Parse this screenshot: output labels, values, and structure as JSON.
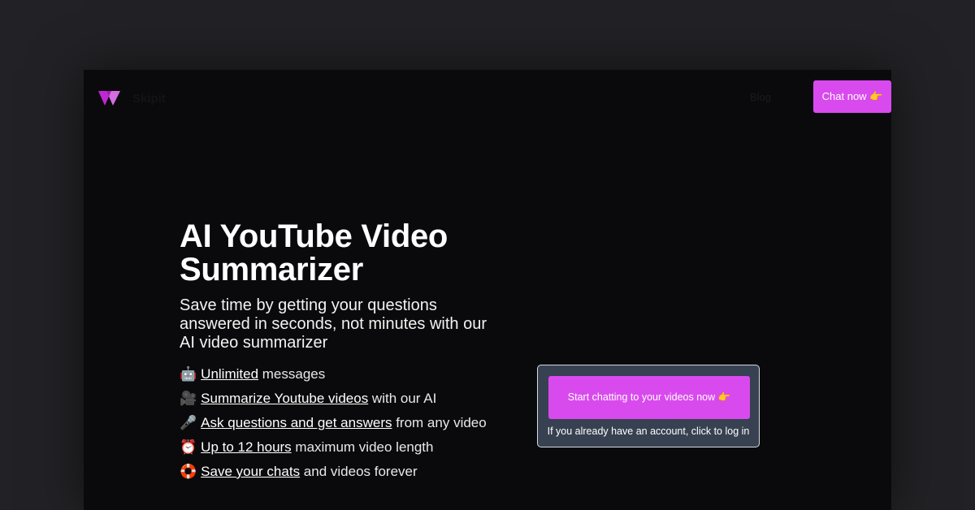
{
  "header": {
    "brand": "Skipit",
    "nav_blog": "Blog",
    "chat_button": "Chat now 👉"
  },
  "hero": {
    "title_line1": "AI YouTube Video",
    "title_line2": "Summarizer",
    "subtitle": "Save time by getting your questions answered in seconds, not minutes with our AI video summarizer"
  },
  "features": [
    {
      "emoji": "🤖",
      "link": "Unlimited",
      "text": " messages"
    },
    {
      "emoji": "🎥",
      "link": "Summarize Youtube videos",
      "text": " with our AI"
    },
    {
      "emoji": "🎤",
      "link": "Ask questions and get answers",
      "text": " from any video"
    },
    {
      "emoji": "⏰",
      "link": "Up to 12 hours",
      "text": " maximum video length"
    },
    {
      "emoji": "🛟",
      "link": "Save your chats",
      "text": " and videos forever"
    }
  ],
  "cta": {
    "button": "Start chatting to your videos now 👉",
    "login": "If you already have an account, click to log in"
  },
  "colors": {
    "accent": "#d94aee",
    "panel_bg": "#0a0a0c",
    "cta_box_bg": "#374151"
  },
  "icons": {
    "logo": "skipit-logo-icon"
  }
}
